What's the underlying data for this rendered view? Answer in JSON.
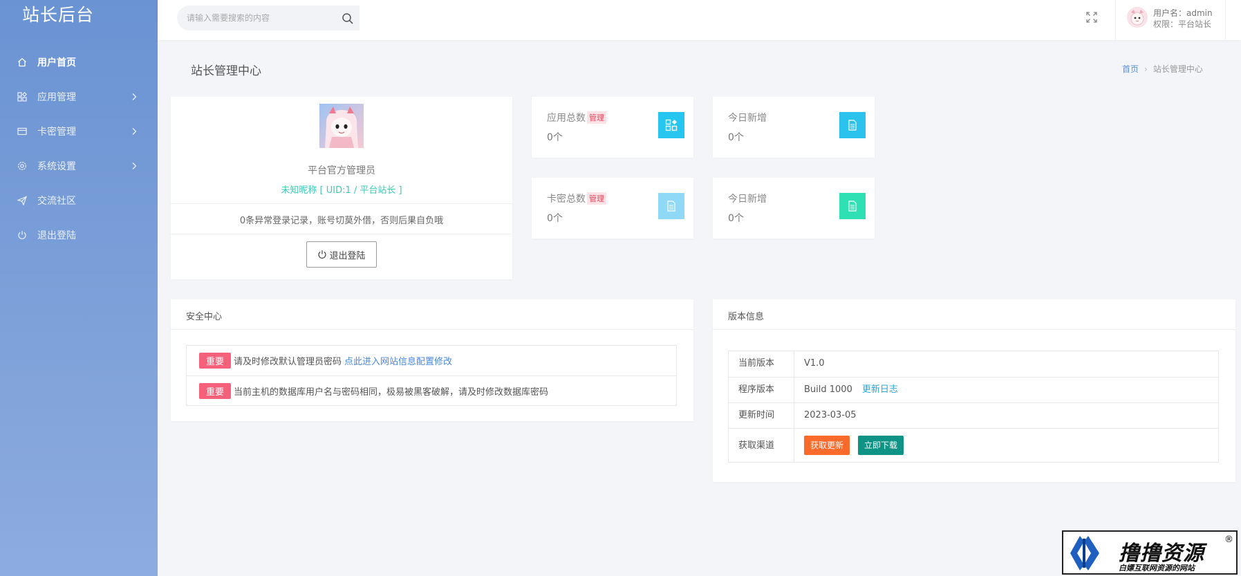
{
  "sidebar": {
    "logo": "站长后台",
    "items": [
      {
        "label": "用户首页",
        "icon": "home-icon",
        "active": true,
        "has_children": false
      },
      {
        "label": "应用管理",
        "icon": "apps-icon",
        "active": false,
        "has_children": true
      },
      {
        "label": "卡密管理",
        "icon": "card-icon",
        "active": false,
        "has_children": true
      },
      {
        "label": "系统设置",
        "icon": "settings-icon",
        "active": false,
        "has_children": true
      },
      {
        "label": "交流社区",
        "icon": "send-icon",
        "active": false,
        "has_children": false
      },
      {
        "label": "退出登陆",
        "icon": "power-icon",
        "active": false,
        "has_children": false
      }
    ]
  },
  "topbar": {
    "search_placeholder": "请输入需要搜索的内容",
    "user_name": "用户名：admin",
    "user_role": "权限：平台站长"
  },
  "page": {
    "title": "站长管理中心",
    "breadcrumb": {
      "home": "首页",
      "sep": "›",
      "current": "站长管理中心"
    }
  },
  "profile": {
    "name": "平台官方管理员",
    "uid_line": "未知昵称 [ UID:1 / 平台站长 ]",
    "notice": "0条异常登录记录，账号切莫外借，否则后果自负哦",
    "logout_label": "退出登陆"
  },
  "stats": [
    {
      "label": "应用总数",
      "badge": "管理",
      "value": "0个",
      "icon": "apps-icon",
      "color": "#26c6f0"
    },
    {
      "label": "今日新增",
      "badge": "",
      "value": "0个",
      "icon": "document-icon",
      "color": "#2bc2ee"
    },
    {
      "label": "卡密总数",
      "badge": "管理",
      "value": "0个",
      "icon": "document-icon",
      "color": "#8fd9f7"
    },
    {
      "label": "今日新增",
      "badge": "",
      "value": "0个",
      "icon": "document-icon",
      "color": "#2ee0b4"
    }
  ],
  "security": {
    "title": "安全中心",
    "items": [
      {
        "tag": "重要",
        "text": "请及时修改默认管理员密码",
        "link": "点此进入网站信息配置修改"
      },
      {
        "tag": "重要",
        "text": "当前主机的数据库用户名与密码相同，极易被黑客破解，请及时修改数据库密码",
        "link": ""
      }
    ]
  },
  "version": {
    "title": "版本信息",
    "rows": {
      "current_label": "当前版本",
      "current_value": "V1.0",
      "program_label": "程序版本",
      "program_value": "Build 1000",
      "changelog_link": "更新日志",
      "time_label": "更新时间",
      "time_value": "2023-03-05",
      "channel_label": "获取渠道",
      "get_update": "获取更新",
      "download_now": "立即下载"
    }
  },
  "watermark": {
    "title": "撸撸资源",
    "reg": "®",
    "subtitle": "白嫖互联网资源的网站"
  },
  "colors": {
    "sidebar_top": "#6a93d3",
    "sidebar_bottom": "#8dacdf",
    "accent_teal": "#3cc9b4",
    "important_tag": "#f5607a",
    "btn_orange": "#fa6a2b",
    "btn_teal": "#0e9384"
  }
}
